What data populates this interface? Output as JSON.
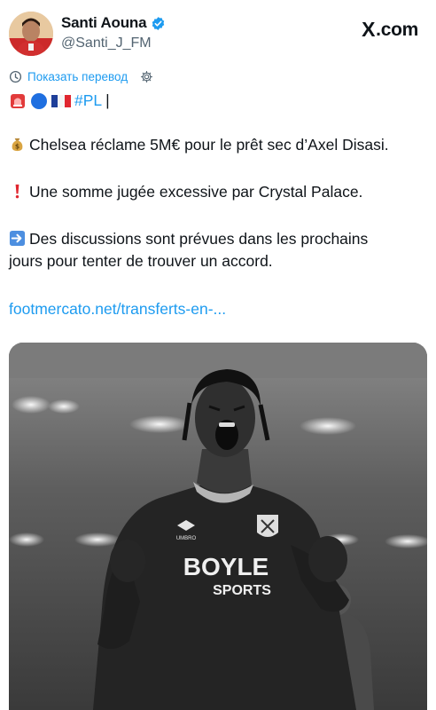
{
  "header": {
    "display_name": "Santi Aouna",
    "handle": "@Santi_J_FM",
    "site": ".com",
    "site_logo": "X"
  },
  "translate": {
    "label": "Показать перевод"
  },
  "tweet": {
    "tag": "#PL",
    "cursor": "|",
    "line1": "Chelsea réclame 5M€ pour le prêt sec d’Axel Disasi.",
    "line2": "Une somme jugée excessive par Crystal Palace.",
    "line3a": "Des discussions sont prévues dans les prochains",
    "line3b": "jours pour tenter de trouver un accord.",
    "link": "footmercato.net/transferts-en-..."
  },
  "media": {
    "shirt_sponsor_top": "BOYLE",
    "shirt_sponsor_bottom": "SPORTS",
    "kit_brand": "UMBRO"
  },
  "colors": {
    "link": "#1d9bf0",
    "text": "#0f1419",
    "secondary": "#536471"
  }
}
